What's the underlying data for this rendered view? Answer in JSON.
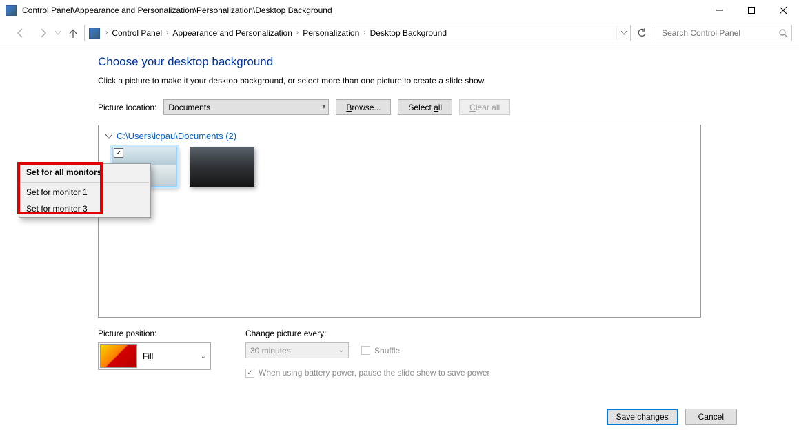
{
  "window": {
    "title": "Control Panel\\Appearance and Personalization\\Personalization\\Desktop Background"
  },
  "breadcrumb": {
    "items": [
      "Control Panel",
      "Appearance and Personalization",
      "Personalization",
      "Desktop Background"
    ]
  },
  "search": {
    "placeholder": "Search Control Panel"
  },
  "main": {
    "heading": "Choose your desktop background",
    "subtext": "Click a picture to make it your desktop background, or select more than one picture to create a slide show.",
    "picture_location_label": "Picture location:",
    "picture_location_value": "Documents",
    "browse_label": "Browse...",
    "select_all_label": "Select all",
    "clear_all_label": "Clear all",
    "group_header": "C:\\Users\\icpau\\Documents (2)",
    "picture_position_label": "Picture position:",
    "picture_position_value": "Fill",
    "change_every_label": "Change picture every:",
    "change_every_value": "30 minutes",
    "shuffle_label": "Shuffle",
    "battery_label": "When using battery power, pause the slide show to save power"
  },
  "context_menu": {
    "items": [
      "Set for all monitors",
      "Set for monitor 1",
      "Set for monitor 3"
    ]
  },
  "footer": {
    "save": "Save changes",
    "cancel": "Cancel"
  }
}
